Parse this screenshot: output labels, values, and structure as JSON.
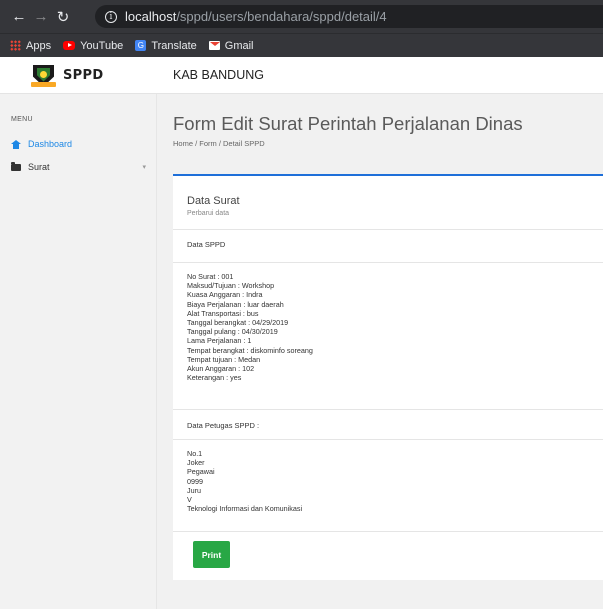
{
  "browser": {
    "url_host": "localhost",
    "url_path": "/sppd/users/bendahara/sppd/detail/4",
    "bookmarks": [
      "Apps",
      "YouTube",
      "Translate",
      "Gmail"
    ]
  },
  "header": {
    "brand": "SPPD",
    "title": "KAB BANDUNG"
  },
  "sidebar": {
    "menu_label": "MENU",
    "items": [
      {
        "label": "Dashboard",
        "icon": "home-icon",
        "color": "#1e88e5"
      },
      {
        "label": "Surat",
        "icon": "folder-icon",
        "color": "#333333"
      }
    ]
  },
  "page": {
    "title": "Form Edit Surat Perintah Perjalanan Dinas",
    "breadcrumb": "Home / Form / Detail SPPD"
  },
  "card": {
    "title": "Data Surat",
    "subtitle": "Perbarui data",
    "section_sppd": "Data SPPD",
    "details": [
      "No Surat : 001",
      "Maksud/Tujuan : Workshop",
      "Kuasa Anggaran : Indra",
      "Biaya Perjalanan : luar daerah",
      "Alat Transportasi : bus",
      "Tanggal berangkat : 04/29/2019",
      "Tanggal pulang : 04/30/2019",
      "Lama Perjalanan : 1",
      "Tempat berangkat : diskominfo soreang",
      "Tempat tujuan : Medan",
      "Akun Anggaran : 102",
      "Keterangan : yes"
    ],
    "section_petugas": "Data Petugas SPPD :",
    "petugas": [
      "No.1",
      "Joker",
      "Pegawai",
      "0999",
      "Juru",
      "V",
      "Teknologi Informasi dan Komunikasi"
    ],
    "print_label": "Print"
  },
  "colors": {
    "accent": "#1e6fd9",
    "print_button": "#28a745"
  }
}
